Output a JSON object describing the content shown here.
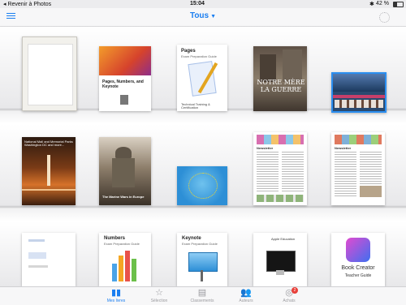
{
  "status_bar": {
    "back_app": "Revenir à Photos",
    "time": "15:04",
    "battery": "42 %"
  },
  "header": {
    "title": "Tous",
    "list_icon": "list-icon",
    "sync_icon": "sync-spinner-icon"
  },
  "books": [
    {
      "id": "blank",
      "title": ""
    },
    {
      "id": "pages-numbers-keynote",
      "title": "Pages, Numbers, and Keynote"
    },
    {
      "id": "pages-guide",
      "title": "Pages",
      "subtitle": "Exam Preparation Guide",
      "footer": "Technical Training & Certification"
    },
    {
      "id": "notre-guerre",
      "title": "NOTRE MÈRE LA GUERRE"
    },
    {
      "id": "photo-book",
      "title": ""
    },
    {
      "id": "washington",
      "title": "National Mall and Memorial Parks Washington DC and more..."
    },
    {
      "id": "soldier",
      "title": "The Marine Wars in Europe"
    },
    {
      "id": "europe-flag",
      "title": ""
    },
    {
      "id": "newsletter-1",
      "title": "Newsletter"
    },
    {
      "id": "newsletter-2",
      "title": "Newsletter"
    },
    {
      "id": "doc-book",
      "title": ""
    },
    {
      "id": "numbers-guide",
      "title": "Numbers",
      "subtitle": "Exam Preparation Guide"
    },
    {
      "id": "keynote-guide",
      "title": "Keynote",
      "subtitle": "Exam Preparation Guide"
    },
    {
      "id": "display-guide",
      "title": "Apple Education"
    },
    {
      "id": "book-creator",
      "title": "Book Creator",
      "subtitle": "Teacher Guide"
    }
  ],
  "tabs": [
    {
      "label": "Mes livres",
      "icon": "book-icon",
      "active": true
    },
    {
      "label": "Sélection",
      "icon": "star-icon",
      "active": false
    },
    {
      "label": "Classements",
      "icon": "list-grid-icon",
      "active": false
    },
    {
      "label": "Auteurs",
      "icon": "people-icon",
      "active": false
    },
    {
      "label": "Achats",
      "icon": "cloud-download-icon",
      "active": false,
      "badge": "2"
    }
  ],
  "colors": {
    "accent": "#1a7ef0",
    "badge": "#e8403a"
  }
}
